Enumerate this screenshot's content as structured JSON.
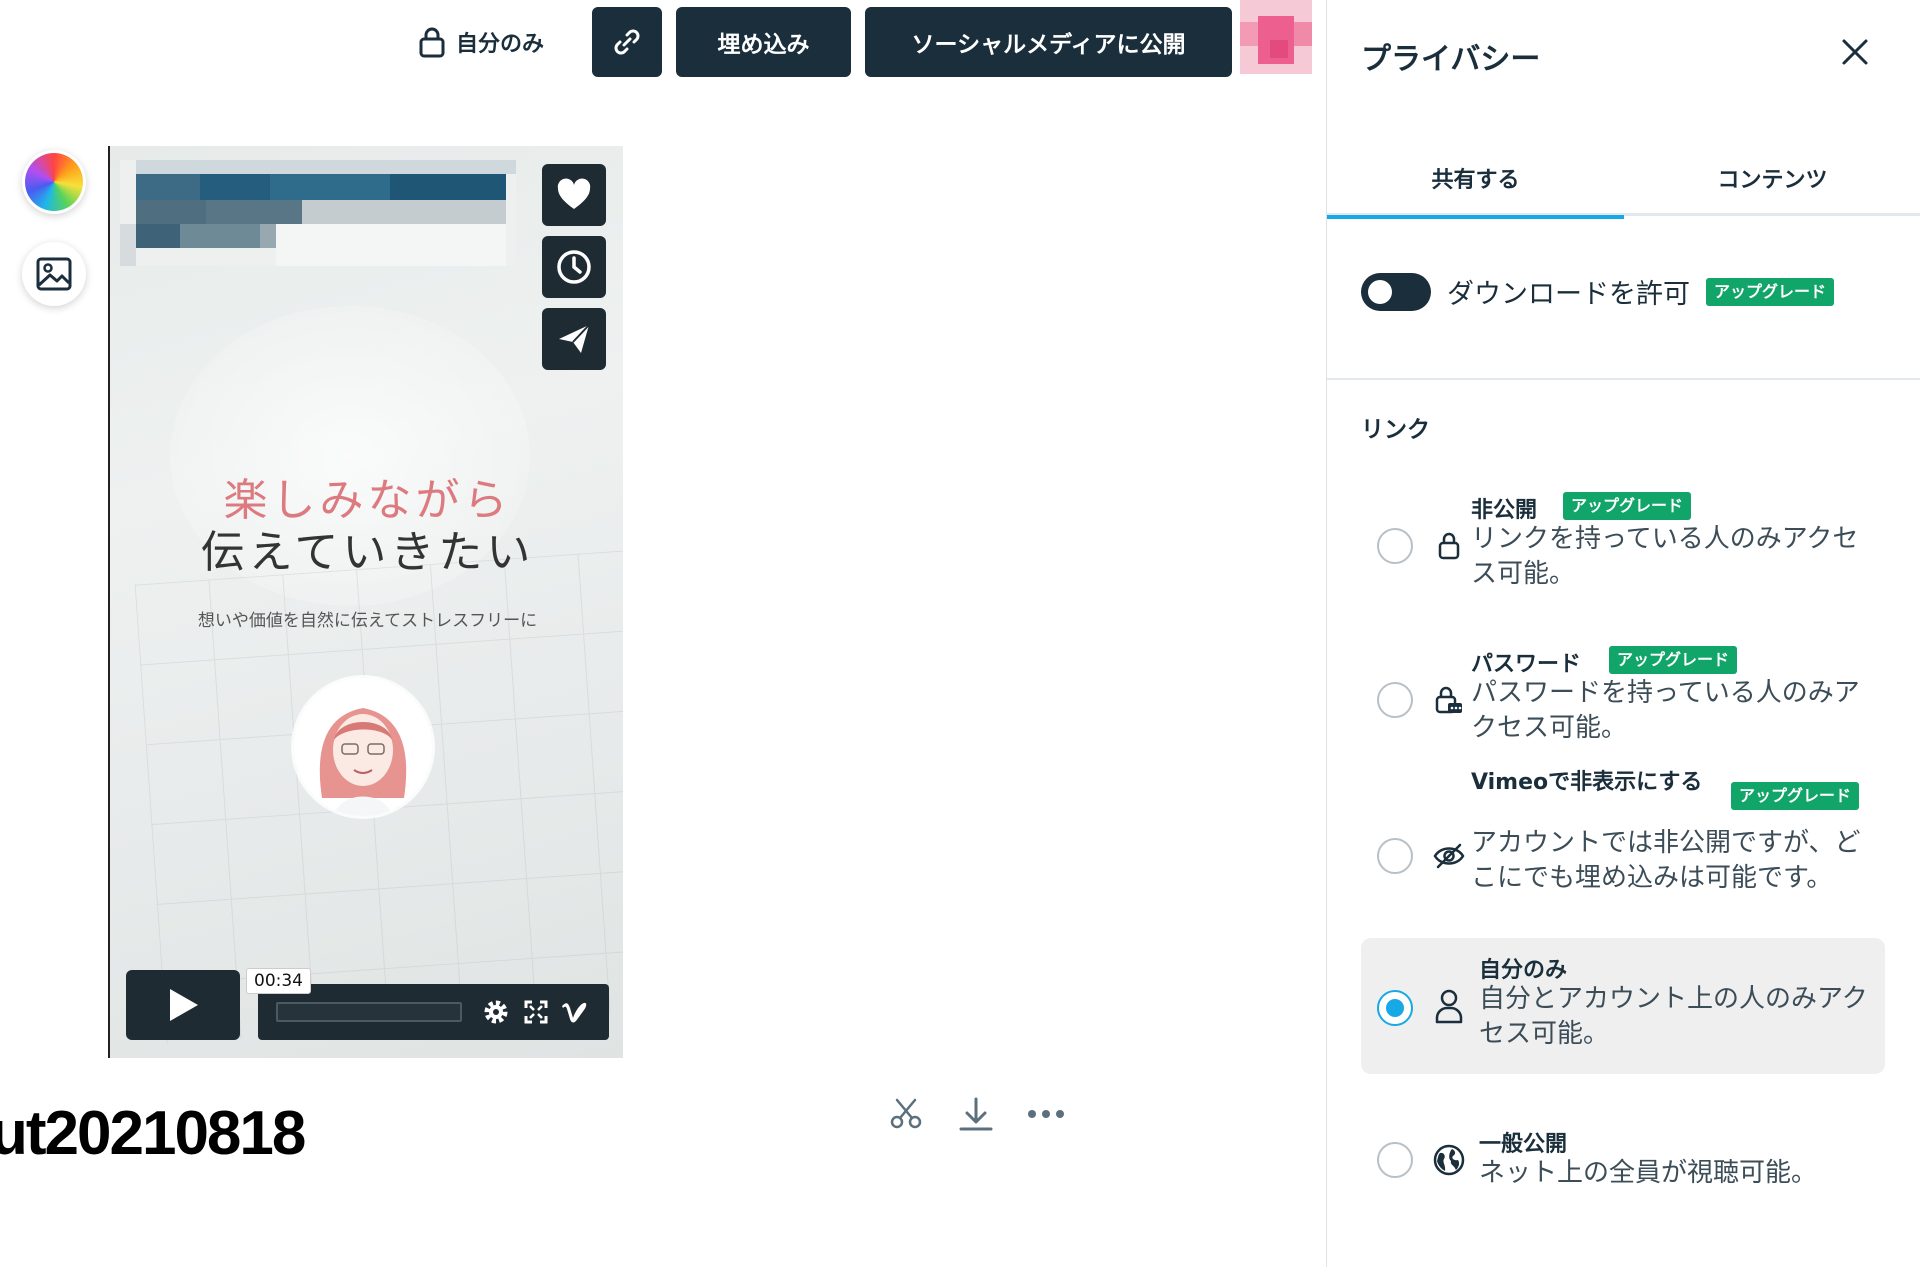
{
  "topbar": {
    "privacy_label": "自分のみ",
    "embed_label": "埋め込み",
    "social_label": "ソーシャルメディアに公開"
  },
  "video": {
    "title_line1": "楽しみながら",
    "title_line2": "伝えていきたい",
    "subtitle": "想いや価値を自然に伝えてストレスフリーに",
    "timestamp": "00:34",
    "name": "ut20210818"
  },
  "panel": {
    "title": "プライバシー",
    "tabs": [
      "共有する",
      "コンテンツ"
    ],
    "download_label": "ダウンロードを許可",
    "upgrade_badge": "アップグレード",
    "link_section": "リンク",
    "options": [
      {
        "title": "非公開",
        "desc": "リンクを持っている人のみアクセス可能。",
        "badge": "アップグレード",
        "icon": "lock-icon"
      },
      {
        "title": "パスワード",
        "desc": "パスワードを持っている人のみアクセス可能。",
        "badge": "アップグレード",
        "icon": "password-lock-icon"
      },
      {
        "title": "Vimeoで非表示にする",
        "desc": "アカウントでは非公開ですが、どこにでも埋め込みは可能です。",
        "badge": "アップグレード",
        "icon": "eye-slash-icon"
      },
      {
        "title": "自分のみ",
        "desc": "自分とアカウント上の人のみアクセス可能。",
        "icon": "person-icon",
        "selected": true
      },
      {
        "title": "一般公開",
        "desc": "ネット上の全員が視聴可能。",
        "icon": "globe-icon"
      }
    ]
  },
  "colors": {
    "dark": "#1a2e3b",
    "accent_blue": "#17a8e6",
    "upgrade_green": "#11a569"
  }
}
